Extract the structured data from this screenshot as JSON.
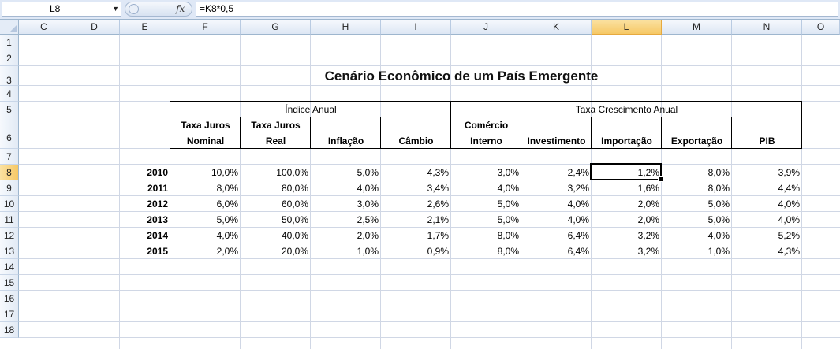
{
  "formula_bar": {
    "name_box": "L8",
    "fx_label": "fx",
    "formula": "=K8*0,5"
  },
  "columns": [
    "C",
    "D",
    "E",
    "F",
    "G",
    "H",
    "I",
    "J",
    "K",
    "L",
    "M",
    "N",
    "O"
  ],
  "rows": [
    "1",
    "2",
    "3",
    "4",
    "5",
    "6",
    "7",
    "8",
    "9",
    "10",
    "11",
    "12",
    "13",
    "14",
    "15",
    "16",
    "17",
    "18"
  ],
  "selected_column": "L",
  "selected_row": "8",
  "sheet": {
    "title": "Cenário Econômico de um País Emergente",
    "group_headers": [
      "Índice Anual",
      "Taxa Crescimento Anual"
    ],
    "sub_headers": [
      {
        "line1": "Taxa Juros",
        "line2": "Nominal"
      },
      {
        "line1": "Taxa Juros",
        "line2": "Real"
      },
      {
        "line1": "",
        "line2": "Inflação"
      },
      {
        "line1": "",
        "line2": "Câmbio"
      },
      {
        "line1": "Comércio",
        "line2": "Interno"
      },
      {
        "line1": "",
        "line2": "Investimento"
      },
      {
        "line1": "",
        "line2": "Importação"
      },
      {
        "line1": "",
        "line2": "Exportação"
      },
      {
        "line1": "",
        "line2": "PIB"
      }
    ],
    "data_rows": [
      {
        "year": "2010",
        "values": [
          "10,0%",
          "100,0%",
          "5,0%",
          "4,3%",
          "3,0%",
          "2,4%",
          "1,2%",
          "8,0%",
          "3,9%"
        ]
      },
      {
        "year": "2011",
        "values": [
          "8,0%",
          "80,0%",
          "4,0%",
          "3,4%",
          "4,0%",
          "3,2%",
          "1,6%",
          "8,0%",
          "4,4%"
        ]
      },
      {
        "year": "2012",
        "values": [
          "6,0%",
          "60,0%",
          "3,0%",
          "2,6%",
          "5,0%",
          "4,0%",
          "2,0%",
          "5,0%",
          "4,0%"
        ]
      },
      {
        "year": "2013",
        "values": [
          "5,0%",
          "50,0%",
          "2,5%",
          "2,1%",
          "5,0%",
          "4,0%",
          "2,0%",
          "5,0%",
          "4,0%"
        ]
      },
      {
        "year": "2014",
        "values": [
          "4,0%",
          "40,0%",
          "2,0%",
          "1,7%",
          "8,0%",
          "6,4%",
          "3,2%",
          "4,0%",
          "5,2%"
        ]
      },
      {
        "year": "2015",
        "values": [
          "2,0%",
          "20,0%",
          "1,0%",
          "0,9%",
          "8,0%",
          "6,4%",
          "3,2%",
          "1,0%",
          "4,3%"
        ]
      }
    ]
  }
}
